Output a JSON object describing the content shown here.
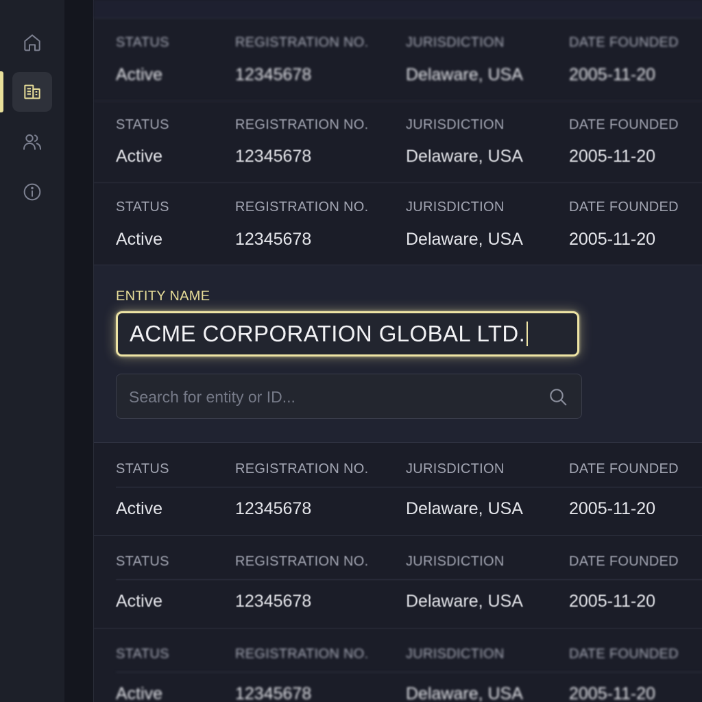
{
  "sidebar": {
    "items": [
      {
        "icon": "home-icon",
        "active": false
      },
      {
        "icon": "building-icon",
        "active": true
      },
      {
        "icon": "users-icon",
        "active": false
      },
      {
        "icon": "info-icon",
        "active": false
      }
    ]
  },
  "columns": {
    "status": "STATUS",
    "registration": "REGISTRATION NO.",
    "jurisdiction": "JURISDICTION",
    "date_founded": "DATE FOUNDED"
  },
  "records": [
    {
      "status": "Active",
      "registration": "12345678",
      "jurisdiction": "Delaware, USA",
      "date_founded": "2005-11-20"
    },
    {
      "status": "Active",
      "registration": "12345678",
      "jurisdiction": "Delaware, USA",
      "date_founded": "2005-11-20"
    },
    {
      "status": "Active",
      "registration": "12345678",
      "jurisdiction": "Delaware, USA",
      "date_founded": "2005-11-20"
    },
    {
      "status": "Active",
      "registration": "12345678",
      "jurisdiction": "Delaware, USA",
      "date_founded": "2005-11-20"
    },
    {
      "status": "Active",
      "registration": "12345678",
      "jurisdiction": "Delaware, USA",
      "date_founded": "2005-11-20"
    },
    {
      "status": "Active",
      "registration": "12345678",
      "jurisdiction": "Delaware, USA",
      "date_founded": "2005-11-20"
    }
  ],
  "entity": {
    "label": "ENTITY NAME",
    "value": "ACME CORPORATION GLOBAL LTD."
  },
  "search": {
    "placeholder": "Search for entity or ID..."
  },
  "colors": {
    "accent": "#ede3a4",
    "background": "#1b1d28",
    "sidebar": "#1d2029"
  }
}
